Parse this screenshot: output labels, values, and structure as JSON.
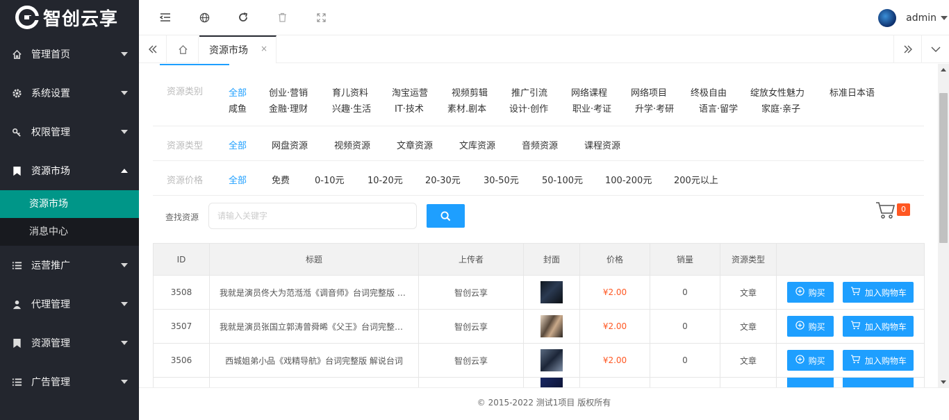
{
  "app": {
    "logo_text": "智创云享"
  },
  "sidebar": {
    "items": [
      {
        "label": "管理首页",
        "icon": "home-icon"
      },
      {
        "label": "系统设置",
        "icon": "gear-icon"
      },
      {
        "label": "权限管理",
        "icon": "key-icon"
      },
      {
        "label": "资源市场",
        "icon": "bookmark-icon"
      },
      {
        "label": "运营推广",
        "icon": "list-icon"
      },
      {
        "label": "代理管理",
        "icon": "user-icon"
      },
      {
        "label": "资源管理",
        "icon": "bookmark-icon"
      },
      {
        "label": "广告管理",
        "icon": "list-icon"
      }
    ],
    "subitems": [
      {
        "label": "资源市场",
        "active": true
      },
      {
        "label": "消息中心",
        "active": false
      }
    ]
  },
  "header": {
    "username": "admin"
  },
  "tabs": {
    "active_label": "资源市场",
    "close": "×"
  },
  "filters": {
    "category_label": "资源类别",
    "categories_row1": [
      "全部",
      "创业·营销",
      "育儿资料",
      "淘宝运营",
      "视频剪辑",
      "推广引流",
      "网络课程",
      "网络项目",
      "终极自由",
      "绽放女性魅力",
      "标准日本语"
    ],
    "categories_row2": [
      "咸鱼",
      "金融·理财",
      "兴趣·生活",
      "IT·技术",
      "素材.剧本",
      "设计·创作",
      "职业·考证",
      "升学·考研",
      "语言·留学",
      "家庭·亲子"
    ],
    "type_label": "资源类型",
    "types": [
      "全部",
      "网盘资源",
      "视频资源",
      "文章资源",
      "文库资源",
      "音频资源",
      "课程资源"
    ],
    "price_label": "资源价格",
    "prices": [
      "全部",
      "免费",
      "0-10元",
      "10-20元",
      "20-30元",
      "30-50元",
      "50-100元",
      "100-200元",
      "200元以上"
    ]
  },
  "search": {
    "label": "查找资源",
    "placeholder": "请输入关键字",
    "value": ""
  },
  "cart": {
    "count": "0"
  },
  "table": {
    "headers": [
      "ID",
      "标题",
      "上传者",
      "封面",
      "价格",
      "销量",
      "资源类型",
      ""
    ],
    "rows": [
      {
        "id": "3508",
        "title": "我就是演员佟大为范湉湉《调音师》台词完整版 解说台词",
        "uploader": "智创云享",
        "price": "¥2.00",
        "sales": "0",
        "type": "文章"
      },
      {
        "id": "3507",
        "title": "我就是演员张国立郭涛曾舜晞《父王》台词完整版 解说台词",
        "uploader": "智创云享",
        "price": "¥2.00",
        "sales": "0",
        "type": "文章"
      },
      {
        "id": "3506",
        "title": "西城姐弟小品《戏精导航》台词完整版 解说台词",
        "uploader": "智创云享",
        "price": "¥2.00",
        "sales": "0",
        "type": "文章"
      },
      {
        "id": "",
        "title": "",
        "uploader": "",
        "price": "",
        "sales": "",
        "type": ""
      }
    ],
    "buy_label": "购买",
    "add_cart_label": "加入购物车"
  },
  "footer": {
    "text": "© 2015-2022 测试1项目 版权所有"
  }
}
